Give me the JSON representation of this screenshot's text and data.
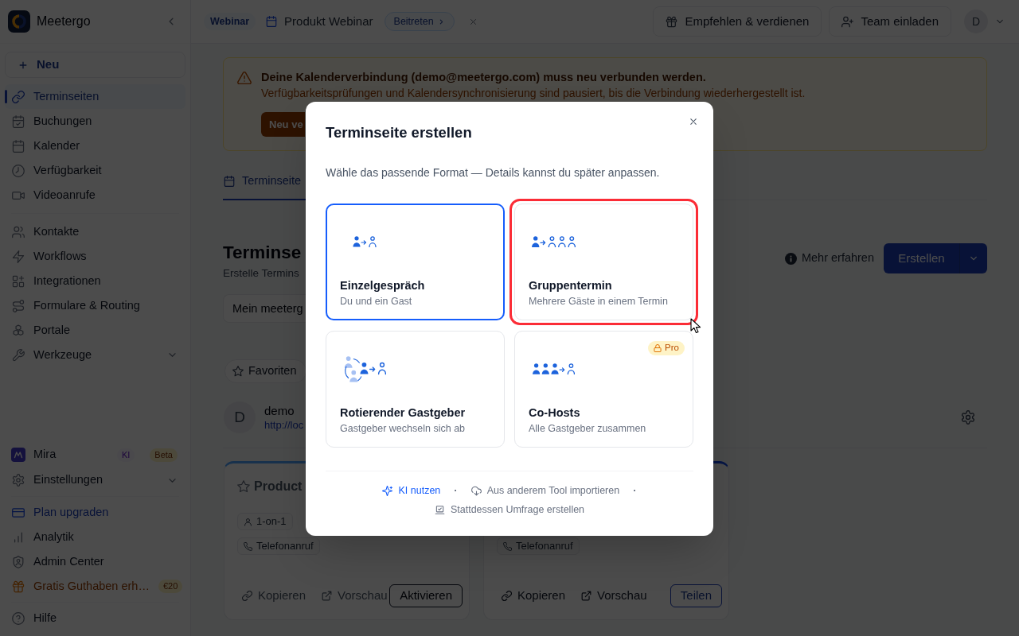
{
  "sidebar": {
    "brand": "Meetergo",
    "new_button": "Neu",
    "top_groups": [
      {
        "items": [
          {
            "kind": "link",
            "label": "Terminseiten",
            "selected": true
          },
          {
            "kind": "link",
            "label": "Buchungen",
            "selected": false
          },
          {
            "kind": "link",
            "label": "Kalender",
            "selected": false
          },
          {
            "kind": "link",
            "label": "Verfügbarkeit",
            "selected": false
          },
          {
            "kind": "link",
            "label": "Videoanrufe",
            "selected": false
          }
        ]
      },
      {
        "items": [
          {
            "kind": "link",
            "label": "Kontakte",
            "selected": false
          },
          {
            "kind": "link",
            "label": "Workflows",
            "selected": false
          },
          {
            "kind": "link",
            "label": "Integrationen",
            "selected": false
          },
          {
            "kind": "link",
            "label": "Formulare & Routing",
            "selected": false
          },
          {
            "kind": "link",
            "label": "Portale",
            "selected": false
          },
          {
            "kind": "group",
            "label": "Werkzeuge",
            "selected": false,
            "expanded": false
          }
        ]
      }
    ],
    "bottom_groups": [
      {
        "items": [
          {
            "kind": "link",
            "label": "Mira",
            "selected": false,
            "badges": [
              {
                "kind": "ai",
                "text": "KI"
              },
              {
                "kind": "beta",
                "text": "Beta"
              }
            ]
          },
          {
            "kind": "group",
            "label": "Einstellungen",
            "selected": false,
            "expanded": false
          }
        ]
      },
      {
        "items": [
          {
            "kind": "upgrade",
            "label": "Plan upgraden",
            "selected": false
          },
          {
            "kind": "link",
            "label": "Analytik",
            "selected": false
          },
          {
            "kind": "link",
            "label": "Admin Center",
            "selected": false
          },
          {
            "kind": "promo",
            "label": "Gratis Guthaben erh…",
            "selected": false,
            "badges": [
              {
                "kind": "credit",
                "text": "€20"
              }
            ]
          }
        ]
      },
      {
        "items": [
          {
            "kind": "link",
            "label": "Hilfe",
            "selected": false
          }
        ]
      }
    ]
  },
  "topbar": {
    "event_tag": "Webinar",
    "event_title": "Produkt Webinar",
    "join_button": "Beitreten",
    "actions": [
      "Empfehlen & verdienen",
      "Team einladen"
    ],
    "avatar": "D"
  },
  "banner": {
    "title": "Deine Kalenderverbindung (demo@meetergo.com) muss neu verbunden werden.",
    "message": "Verfügbarkeitsprüfungen und Kalendersynchronisierung sind pausiert, bis die Verbindung wiederhergestellt ist.",
    "button": "Neu ve"
  },
  "tabs": [
    {
      "label": "Terminseite",
      "selected": true
    }
  ],
  "page_header": {
    "title": "Terminse",
    "subtitle": "Erstelle Termins",
    "learn_more": "Mehr erfahren",
    "create_button": "Erstellen"
  },
  "filters": {
    "dropdown": "Mein meeterg",
    "chips": [
      {
        "label": "Favoriten",
        "selected": false
      }
    ]
  },
  "profile": {
    "avatar": "D",
    "name": "demo",
    "url": "http://loc"
  },
  "event_cards": [
    {
      "active": false,
      "title": "Product",
      "tags": [
        "1-on-1"
      ],
      "channel": "Telefonanruf",
      "links": [
        "Kopieren",
        "Vorschau"
      ],
      "action": "Aktivieren"
    },
    {
      "active": true,
      "channel": "Telefonanruf",
      "links": [
        "Kopieren",
        "Vorschau"
      ],
      "action": "Teilen"
    }
  ],
  "modal": {
    "title": "Terminseite erstellen",
    "subtitle": "Wähle das passende Format — Details kannst du später anpassen.",
    "option_rows": [
      {
        "options": [
          {
            "title": "Einzelgespräch",
            "description": "Du und ein Gast",
            "selected": true,
            "highlighted": false
          },
          {
            "title": "Gruppentermin",
            "description": "Mehrere Gäste in einem Termin",
            "selected": false,
            "highlighted": true
          }
        ]
      },
      {
        "options": [
          {
            "title": "Rotierender Gastgeber",
            "description": "Gastgeber wechseln sich ab",
            "selected": false,
            "highlighted": false
          },
          {
            "title": "Co-Hosts",
            "description": "Alle Gastgeber zusammen",
            "selected": false,
            "highlighted": false,
            "badge": "Pro"
          }
        ]
      }
    ],
    "footer_rows": [
      {
        "items": [
          {
            "kind": "primary",
            "label": "KI nutzen"
          },
          {
            "kind": "separator",
            "text": "·"
          },
          {
            "kind": "link",
            "label": "Aus anderem Tool importieren"
          },
          {
            "kind": "separator",
            "text": "·"
          }
        ]
      },
      {
        "items": [
          {
            "kind": "link",
            "label": "Stattdessen Umfrage erstellen"
          }
        ]
      }
    ]
  }
}
